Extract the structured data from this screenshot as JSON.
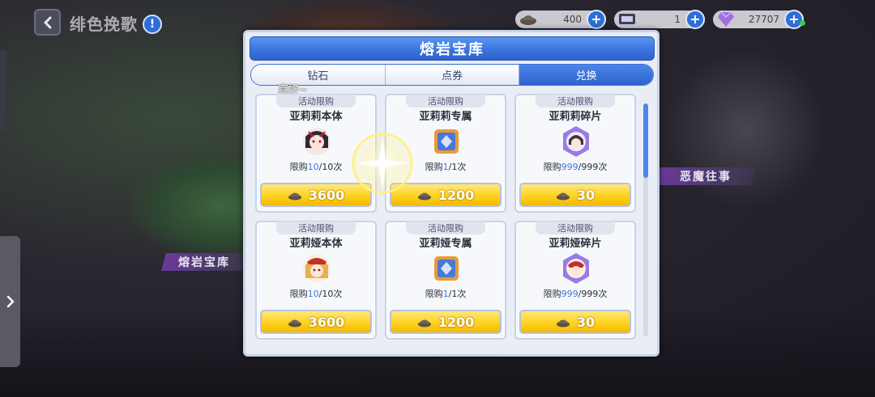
{
  "topbar": {
    "stage_title": "绯色挽歌",
    "info_label": "!"
  },
  "currencies": [
    {
      "icon": "helmet-token-icon",
      "value": "400"
    },
    {
      "icon": "ticket-icon",
      "value": "1"
    },
    {
      "icon": "diamond-icon",
      "value": "27707"
    }
  ],
  "side_labels": {
    "left": "熔岩宝库",
    "right": "恶魔往事"
  },
  "chat_snippet": "真好~",
  "shop": {
    "title": "熔岩宝库",
    "tabs": [
      {
        "label": "钻石",
        "active": false
      },
      {
        "label": "点券",
        "active": false
      },
      {
        "label": "兑换",
        "active": true
      }
    ],
    "items": [
      {
        "tag": "活动限购",
        "name": "亚莉莉本体",
        "limit_prefix": "限购",
        "limit_used": "10",
        "limit_total": "/10次",
        "price": "3600",
        "icon": "lili-portrait-icon"
      },
      {
        "tag": "活动限购",
        "name": "亚莉莉专属",
        "limit_prefix": "限购",
        "limit_used": "1",
        "limit_total": "/1次",
        "price": "1200",
        "icon": "exclusive-box-icon"
      },
      {
        "tag": "活动限购",
        "name": "亚莉莉碎片",
        "limit_prefix": "限购",
        "limit_used": "999",
        "limit_total": "/999次",
        "price": "30",
        "icon": "shard-crystal-icon"
      },
      {
        "tag": "活动限购",
        "name": "亚莉娅本体",
        "limit_prefix": "限购",
        "limit_used": "10",
        "limit_total": "/10次",
        "price": "3600",
        "icon": "liya-portrait-icon"
      },
      {
        "tag": "活动限购",
        "name": "亚莉娅专属",
        "limit_prefix": "限购",
        "limit_used": "1",
        "limit_total": "/1次",
        "price": "1200",
        "icon": "exclusive-box-icon"
      },
      {
        "tag": "活动限购",
        "name": "亚莉娅碎片",
        "limit_prefix": "限购",
        "limit_used": "999",
        "limit_total": "/999次",
        "price": "30",
        "icon": "shard-crystal-icon"
      }
    ]
  },
  "colors": {
    "accent_blue": "#3a74e0",
    "price_gold": "#ffd21f",
    "limit_highlight": "#3f7ae0"
  }
}
